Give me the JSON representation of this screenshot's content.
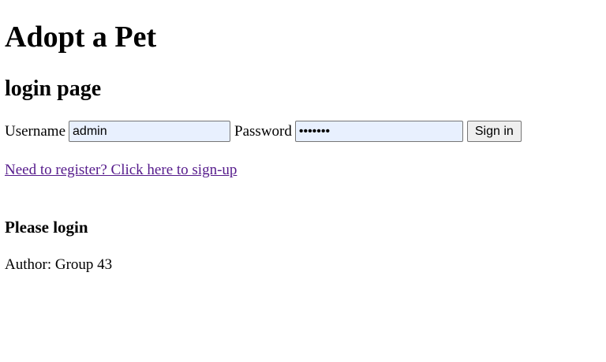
{
  "page": {
    "title": "Adopt a Pet",
    "subtitle": "login page"
  },
  "login_form": {
    "username_label": "Username",
    "username_value": "admin",
    "password_label": "Password",
    "password_value": "•••••••",
    "sign_in_label": "Sign in"
  },
  "register_link": {
    "text": "Need to register? Click here to sign-up"
  },
  "status": {
    "message": "Please login"
  },
  "footer": {
    "author": "Author: Group 43"
  },
  "colors": {
    "link_visited": "#551a8b",
    "autofill_background": "#e8f0fe"
  }
}
